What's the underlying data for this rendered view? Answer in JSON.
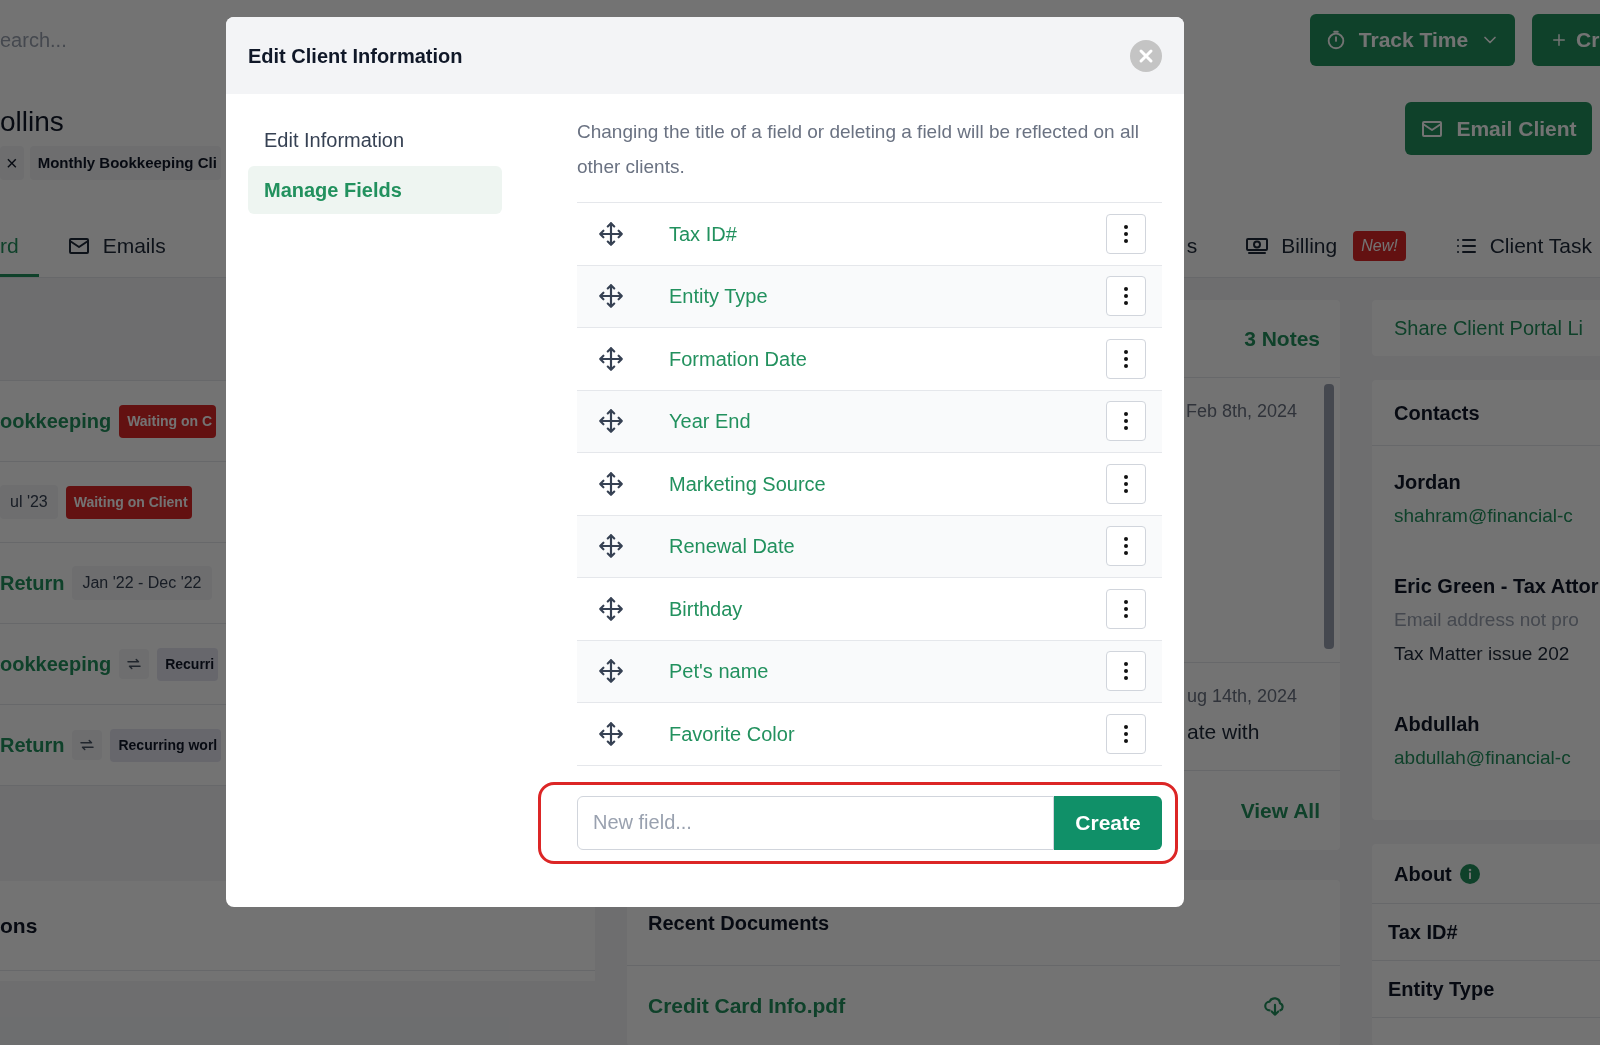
{
  "top_bar": {
    "search_placeholder": "earch...",
    "buttons": [
      {
        "kind": "track_time",
        "label": "Track Time"
      },
      {
        "kind": "create",
        "label": "Cr"
      }
    ]
  },
  "client": {
    "name": "ollins",
    "tags": [
      {
        "kind": "remove",
        "glyph": "×"
      },
      {
        "kind": "label",
        "label": "Monthly Bookkeeping Cli"
      }
    ],
    "email_button": "Email Client"
  },
  "tabs": [
    {
      "label": "rd",
      "kind": "plain",
      "selected": true
    },
    {
      "label": "Emails",
      "kind": "emails",
      "selected": false
    },
    {
      "label": "s",
      "kind": "plain",
      "selected": false
    },
    {
      "label": "Billing",
      "kind": "billing",
      "badge": "New!",
      "selected": false
    },
    {
      "label": "Client Task",
      "kind": "tasks",
      "selected": false
    }
  ],
  "work_items": [
    {
      "title": "ookkeeping",
      "recurring": false,
      "badge": {
        "kind": "waiting",
        "label": "Waiting on C"
      }
    },
    {
      "period": "ul '23",
      "recurring": false,
      "badge": {
        "kind": "waiting",
        "label": "Waiting on Client"
      }
    },
    {
      "title": "Return",
      "recurring": false,
      "period": "Jan '22 - Dec '22"
    },
    {
      "title": "ookkeeping",
      "recurring": true,
      "badge": {
        "kind": "recurring",
        "label": "Recurri"
      }
    },
    {
      "title": "Return",
      "recurring": true,
      "badge": {
        "kind": "recurring",
        "label": "Recurring worl"
      }
    }
  ],
  "section": {
    "title": "ons"
  },
  "notes": {
    "count": "3 Notes",
    "items": [
      {
        "date": "Feb 8th, 2024"
      },
      {
        "date": "ug 14th, 2024",
        "text": "ate with"
      }
    ],
    "view_all": "View All"
  },
  "documents": {
    "title": "Recent Documents",
    "files": [
      {
        "name": "Credit Card Info.pdf"
      }
    ]
  },
  "portal_link": "Share Client Portal Li",
  "contacts": {
    "title": "Contacts",
    "items": [
      {
        "name": "Jordan",
        "email": {
          "kind": "address",
          "text": "shahram@financial-c"
        }
      },
      {
        "name": "Eric Green - Tax Attor",
        "email": {
          "kind": "missing",
          "text": "Email address not pro"
        },
        "note": "Tax Matter issue 202"
      },
      {
        "name": "Abdullah",
        "email": {
          "kind": "address",
          "text": "abdullah@financial-c"
        }
      }
    ]
  },
  "about": {
    "title": "About",
    "fields": [
      "Tax ID#",
      "Entity Type"
    ]
  },
  "modal": {
    "title": "Edit Client Information",
    "nav": [
      {
        "label": "Edit Information",
        "selected": false
      },
      {
        "label": "Manage Fields",
        "selected": true
      }
    ],
    "description": "Changing the title of a field or deleting a field will be reflected on all other clients.",
    "fields": [
      "Tax ID#",
      "Entity Type",
      "Formation Date",
      "Year End",
      "Marketing Source",
      "Renewal Date",
      "Birthday",
      "Pet's name",
      "Favorite Color"
    ],
    "new_field": {
      "placeholder": "New field...",
      "button": "Create",
      "highlighted": true
    }
  }
}
